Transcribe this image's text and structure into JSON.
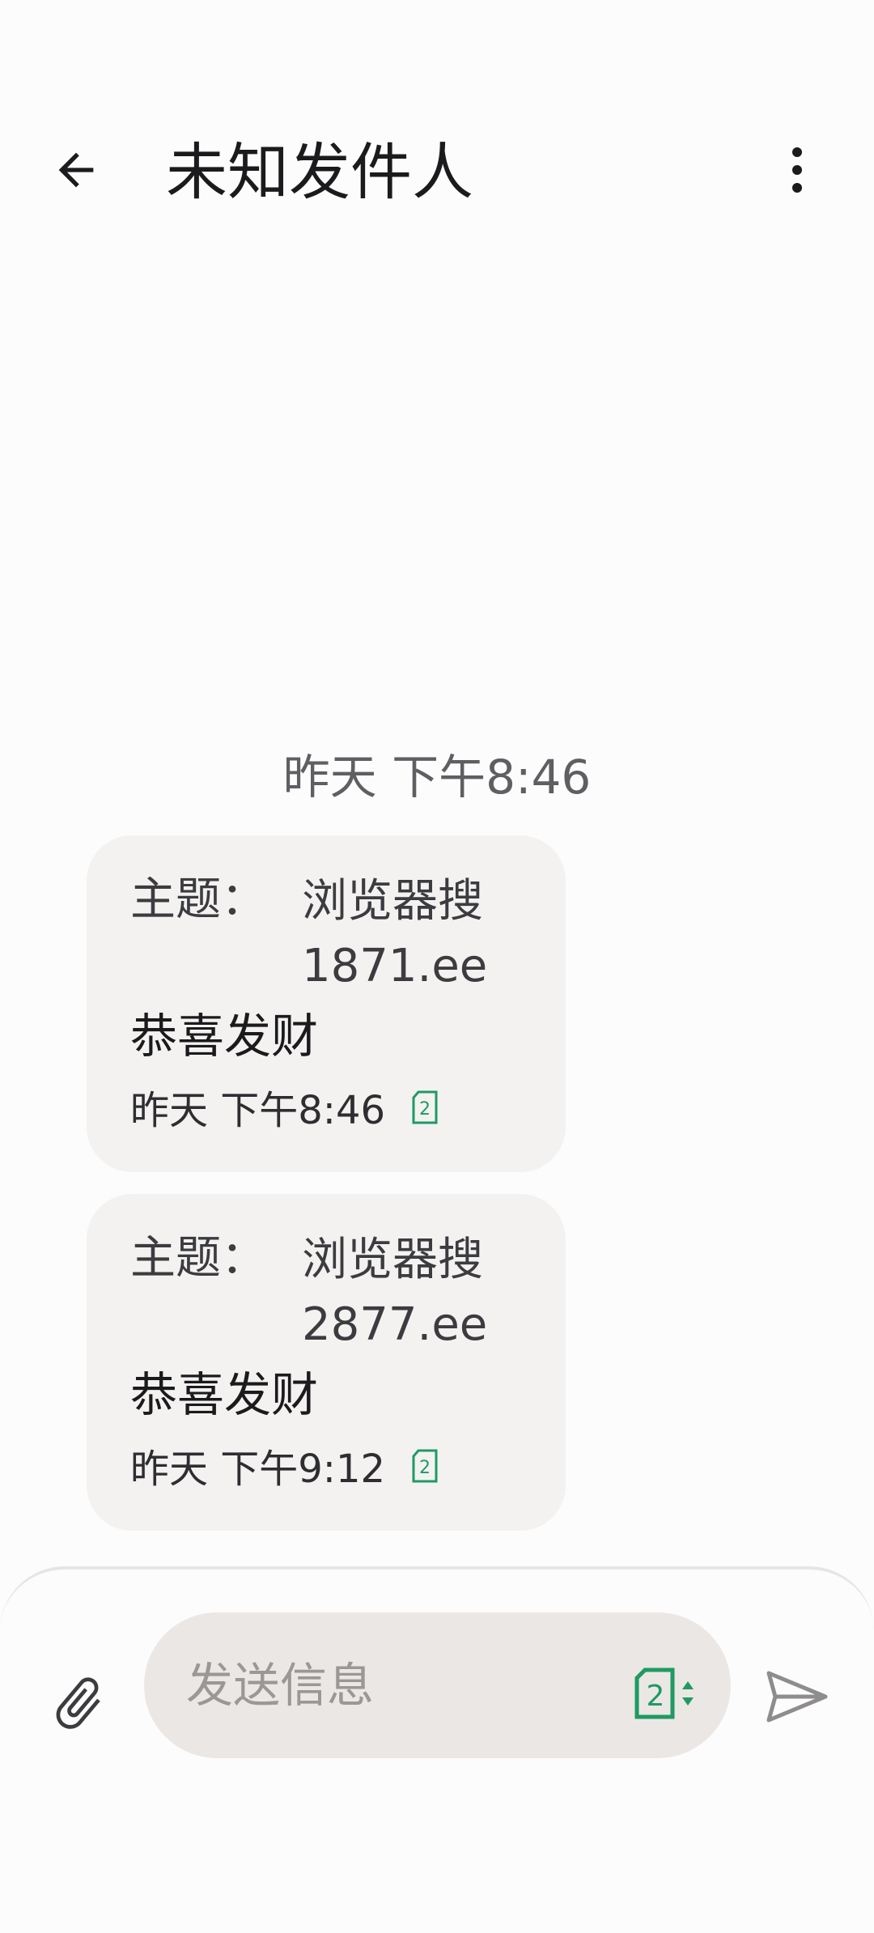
{
  "header": {
    "title": "未知发件人",
    "back_icon": "arrow-back-icon",
    "more_icon": "more-vert-icon"
  },
  "conversation": {
    "date_separator": "昨天 下午8:46",
    "messages": [
      {
        "subject_label": "主题：",
        "subject": "浏览器搜1871.ee",
        "body": "恭喜发财",
        "time": "昨天 下午8:46",
        "sim_icon": "sim-2-icon"
      },
      {
        "subject_label": "主题：",
        "subject": "浏览器搜2877.ee",
        "body": "恭喜发财",
        "time": "昨天 下午9:12",
        "sim_icon": "sim-2-icon"
      }
    ]
  },
  "compose": {
    "placeholder": "发送信息",
    "attach_icon": "paperclip-icon",
    "sim_selector_icon": "sim-2-selector-icon",
    "send_icon": "send-icon"
  },
  "colors": {
    "sim_green": "#1f9a62",
    "bubble": "#f3f2f1",
    "input_bg": "#ebe7e4"
  }
}
